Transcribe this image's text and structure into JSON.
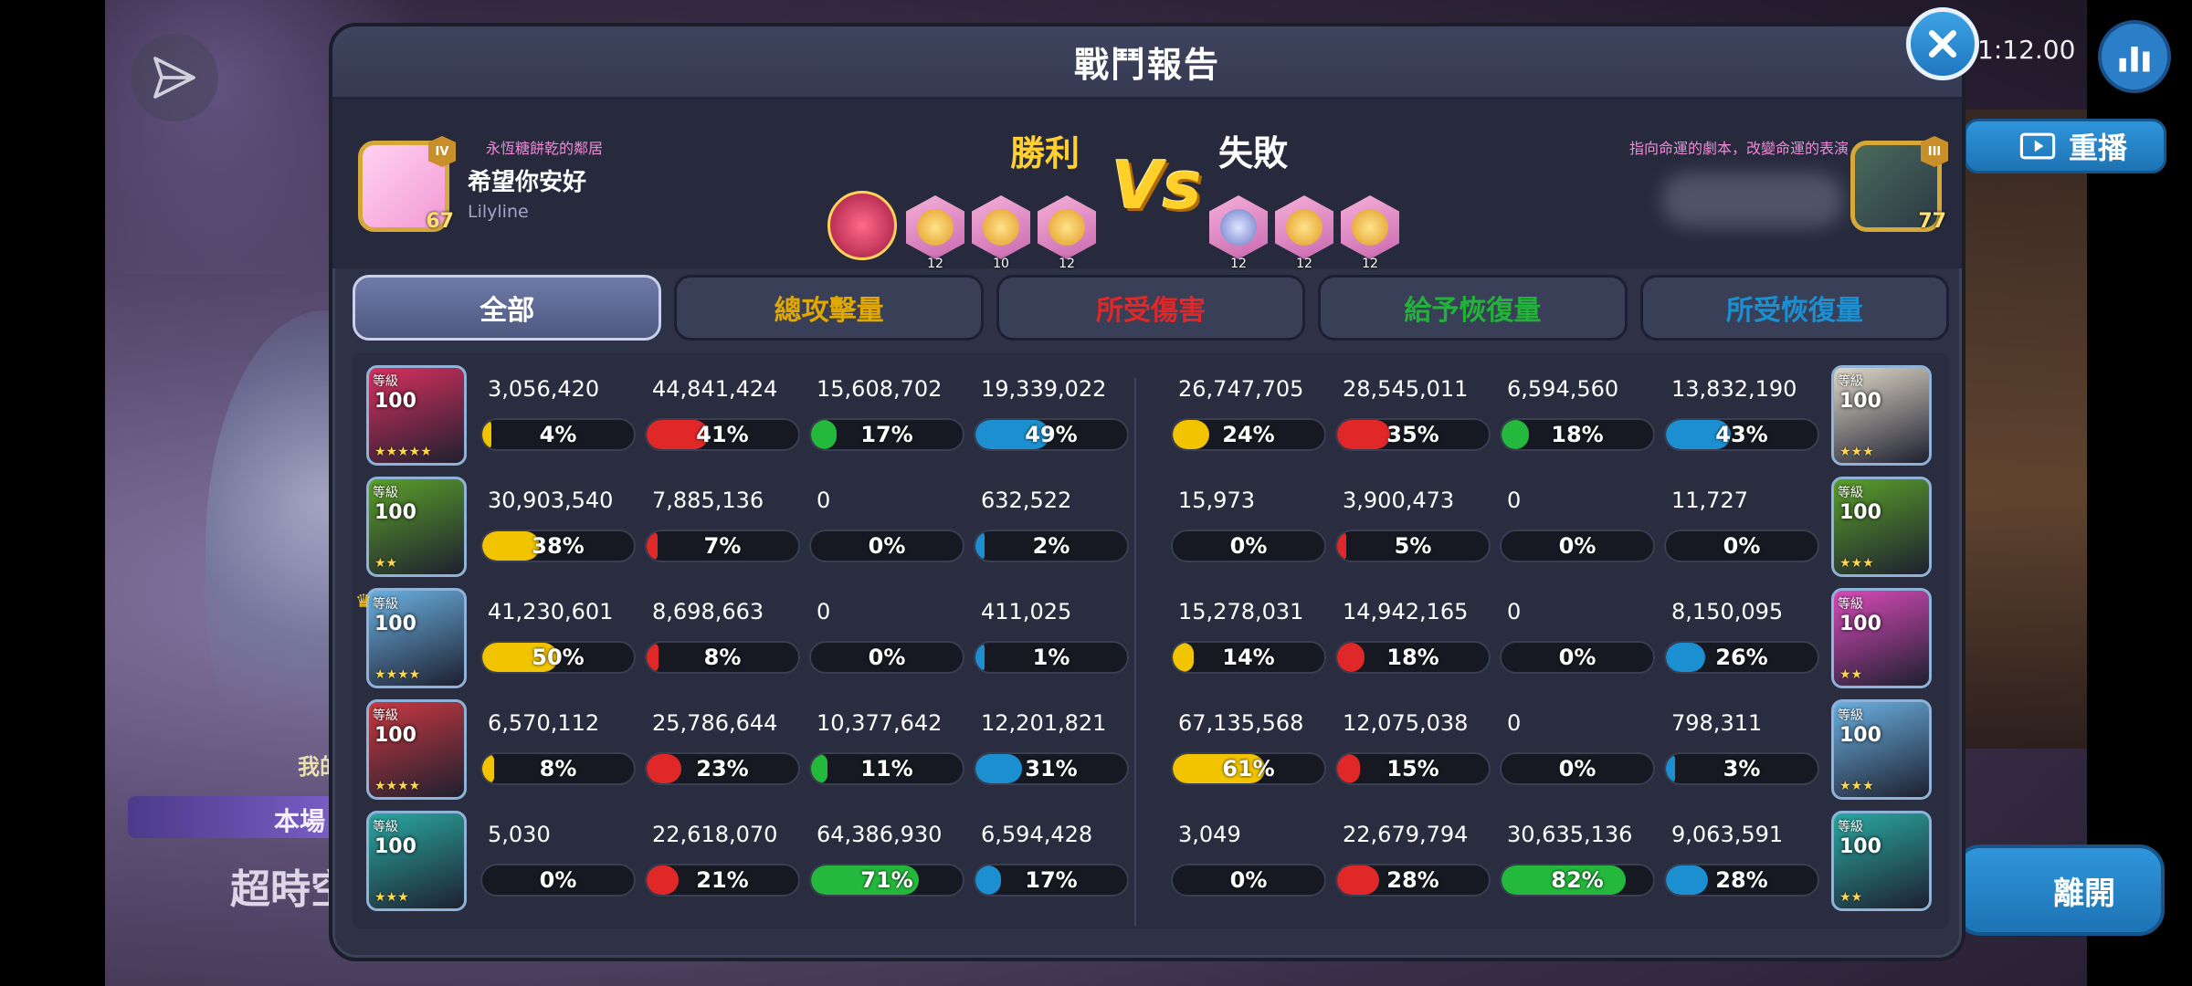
{
  "background": {
    "bg_text_1": "我的",
    "bg_banner": "本場",
    "bg_text_2": "超時空",
    "timer": "1:12.00",
    "replay_label": "重播",
    "leave_label": "離開"
  },
  "panel": {
    "title": "戰鬥報告"
  },
  "left_player": {
    "guild": "永恆糖餅乾的鄰居",
    "name": "希望你安好",
    "id": "Lilyline",
    "level": "67",
    "rank_badge": "IV",
    "result": "勝利",
    "relic_counts": [
      "12",
      "10",
      "12"
    ]
  },
  "right_player": {
    "guild": "指向命運的劇本，改變命運的表演",
    "level": "77",
    "rank_badge": "III",
    "result": "失敗",
    "relic_counts": [
      "12",
      "12",
      "12"
    ]
  },
  "vs_label": "Vs",
  "tabs": [
    "全部",
    "總攻擊量",
    "所受傷害",
    "給予恢復量",
    "所受恢復量"
  ],
  "portrait_level_label": "等級",
  "colors": {
    "attack": "#f2c400",
    "damage": "#e02828",
    "heal": "#24b83c",
    "recv": "#1c8fd0"
  },
  "left_rows": [
    {
      "level": "100",
      "portrait_color": "#d8305e",
      "stars": "★★★★★",
      "stats": [
        {
          "value": "3,056,420",
          "pct": "4%",
          "fill": 0.04
        },
        {
          "value": "44,841,424",
          "pct": "41%",
          "fill": 0.41
        },
        {
          "value": "15,608,702",
          "pct": "17%",
          "fill": 0.17
        },
        {
          "value": "19,339,022",
          "pct": "49%",
          "fill": 0.49
        }
      ]
    },
    {
      "level": "100",
      "portrait_color": "#5a9e2a",
      "stars": "★★",
      "stats": [
        {
          "value": "30,903,540",
          "pct": "38%",
          "fill": 0.38
        },
        {
          "value": "7,885,136",
          "pct": "7%",
          "fill": 0.07
        },
        {
          "value": "0",
          "pct": "0%",
          "fill": 0
        },
        {
          "value": "632,522",
          "pct": "2%",
          "fill": 0.02
        }
      ]
    },
    {
      "level": "100",
      "portrait_color": "#6ab0e0",
      "stars": "★★★★",
      "stats": [
        {
          "value": "41,230,601",
          "pct": "50%",
          "fill": 0.5
        },
        {
          "value": "8,698,663",
          "pct": "8%",
          "fill": 0.08
        },
        {
          "value": "0",
          "pct": "0%",
          "fill": 0
        },
        {
          "value": "411,025",
          "pct": "1%",
          "fill": 0.01
        }
      ]
    },
    {
      "level": "100",
      "portrait_color": "#c83840",
      "stars": "★★★★",
      "stats": [
        {
          "value": "6,570,112",
          "pct": "8%",
          "fill": 0.08
        },
        {
          "value": "25,786,644",
          "pct": "23%",
          "fill": 0.23
        },
        {
          "value": "10,377,642",
          "pct": "11%",
          "fill": 0.11
        },
        {
          "value": "12,201,821",
          "pct": "31%",
          "fill": 0.31
        }
      ]
    },
    {
      "level": "100",
      "portrait_color": "#2aa8a0",
      "stars": "★★★",
      "stats": [
        {
          "value": "5,030",
          "pct": "0%",
          "fill": 0
        },
        {
          "value": "22,618,070",
          "pct": "21%",
          "fill": 0.21
        },
        {
          "value": "64,386,930",
          "pct": "71%",
          "fill": 0.71
        },
        {
          "value": "6,594,428",
          "pct": "17%",
          "fill": 0.17
        }
      ]
    }
  ],
  "right_rows": [
    {
      "level": "100",
      "portrait_color": "#e0d8c8",
      "stars": "★★★",
      "stats": [
        {
          "value": "26,747,705",
          "pct": "24%",
          "fill": 0.24
        },
        {
          "value": "28,545,011",
          "pct": "35%",
          "fill": 0.35
        },
        {
          "value": "6,594,560",
          "pct": "18%",
          "fill": 0.18
        },
        {
          "value": "13,832,190",
          "pct": "43%",
          "fill": 0.43
        }
      ]
    },
    {
      "level": "100",
      "portrait_color": "#5a9e2a",
      "stars": "★★★",
      "stats": [
        {
          "value": "15,973",
          "pct": "0%",
          "fill": 0
        },
        {
          "value": "3,900,473",
          "pct": "5%",
          "fill": 0.05
        },
        {
          "value": "0",
          "pct": "0%",
          "fill": 0
        },
        {
          "value": "11,727",
          "pct": "0%",
          "fill": 0
        }
      ]
    },
    {
      "level": "100",
      "portrait_color": "#d84ab8",
      "stars": "★★",
      "stats": [
        {
          "value": "15,278,031",
          "pct": "14%",
          "fill": 0.14
        },
        {
          "value": "14,942,165",
          "pct": "18%",
          "fill": 0.18
        },
        {
          "value": "0",
          "pct": "0%",
          "fill": 0
        },
        {
          "value": "8,150,095",
          "pct": "26%",
          "fill": 0.26
        }
      ]
    },
    {
      "level": "100",
      "portrait_color": "#6ab0e0",
      "stars": "★★★",
      "stats": [
        {
          "value": "67,135,568",
          "pct": "61%",
          "fill": 0.61
        },
        {
          "value": "12,075,038",
          "pct": "15%",
          "fill": 0.15
        },
        {
          "value": "0",
          "pct": "0%",
          "fill": 0
        },
        {
          "value": "798,311",
          "pct": "3%",
          "fill": 0.03
        }
      ]
    },
    {
      "level": "100",
      "portrait_color": "#2aa8a0",
      "stars": "★★",
      "stats": [
        {
          "value": "3,049",
          "pct": "0%",
          "fill": 0
        },
        {
          "value": "22,679,794",
          "pct": "28%",
          "fill": 0.28
        },
        {
          "value": "30,635,136",
          "pct": "82%",
          "fill": 0.82
        },
        {
          "value": "9,063,591",
          "pct": "28%",
          "fill": 0.28
        }
      ]
    }
  ]
}
